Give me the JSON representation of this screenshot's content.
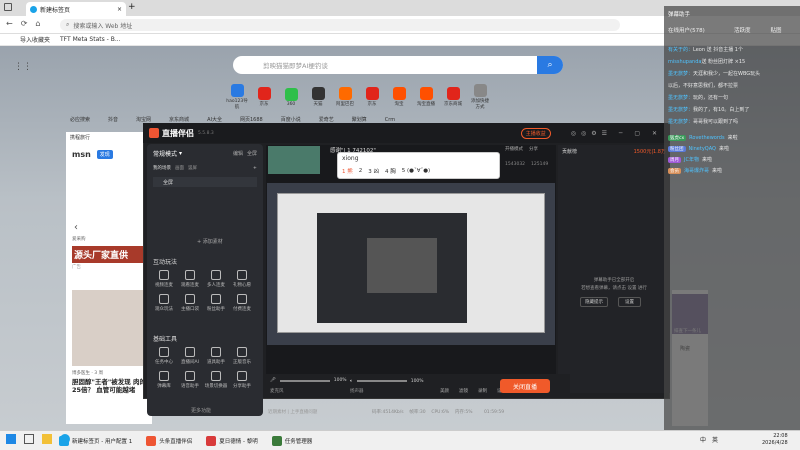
{
  "browser": {
    "tab_title": "新建标签页",
    "address_placeholder": "搜索或输入 Web 地址",
    "favorites": [
      "导入收藏夹",
      "TFT Meta Stats - B..."
    ],
    "search_placeholder": "剪映猫猫即梦AI梗钓谈",
    "quick_links": [
      {
        "label": "hao123导航",
        "color": "#2a7ae2"
      },
      {
        "label": "京东",
        "color": "#e1251b"
      },
      {
        "label": "360",
        "color": "#2fbf4a"
      },
      {
        "label": "天猫",
        "color": "#333"
      },
      {
        "label": "阿里巴巴",
        "color": "#ff6a00"
      },
      {
        "label": "京东",
        "color": "#e1251b"
      },
      {
        "label": "淘宝",
        "color": "#ff5000"
      },
      {
        "label": "淘宝直播",
        "color": "#ff5000"
      },
      {
        "label": "京东商城",
        "color": "#e1251b"
      },
      {
        "label": "添加快捷方式",
        "color": "#888"
      }
    ],
    "second_row": [
      "必应搜索",
      "抖音",
      "淘宝网",
      "京东商城",
      "AI大全",
      "网页1688",
      "百度小说",
      "爱奇艺",
      "聚划算",
      "Crm"
    ],
    "travel_label": "携程旅行",
    "msn_brand": "msn",
    "msn_tab": "发现",
    "news1_title": "源头厂家直供",
    "news1_source": "爱采购",
    "news1_tag": "广告",
    "news2_source": "博多医生 · 3 周",
    "news2_title": "胆固醇\"王者\"被发现 肉的25倍？ 血管可能越堵",
    "right_snippet": "排查下一条儿",
    "right_label": "陶瓷"
  },
  "app": {
    "title": "直播伴侣",
    "version": "5.5.8.3",
    "start_live_top": "主播收益",
    "mode_label": "常规模式",
    "edit_label": "编辑",
    "layout_label": "全屏",
    "my_scene": "我的场景",
    "scene_tabs": [
      "画面",
      "竖屏"
    ],
    "fullscreen_label": "全屏",
    "add_material": "+ 添加素材",
    "interactive_title": "互动玩法",
    "interactive_tools": [
      "视频连麦",
      "观看连麦",
      "多人连麦",
      "礼物心愿",
      "观众玩法",
      "主播口袋",
      "粉丝助手",
      "付费连麦"
    ],
    "basic_title": "基础工具",
    "basic_tools": [
      "任务中心",
      "直播间AI",
      "道具助手",
      "正版音乐",
      "弹幕库",
      "语音助手",
      "场景切换器",
      "分享助手"
    ],
    "more_label": "更多功能",
    "notice_text": "近期素材 | 上手直播问题",
    "ime_input": "xiong",
    "ime_candidates": [
      "1 熊",
      "2 ",
      "3 凶",
      "4 胸",
      "5 (●ˇ∀ˇ●)"
    ],
    "live_title": "感谢\"| 1 742102\"",
    "play_count_label": "开播模式",
    "share_label": "分享",
    "stat_a": "1543032",
    "stat_b": "125149",
    "rank_label": "贡献榜",
    "rank_value": "1500元|1.8万",
    "comment_empty": "弹幕助手已全部开启",
    "comment_hint": "若想查看弹幕，请点击 设置 进行",
    "settings_btn": "设置",
    "hide_btn": "隐藏提示",
    "mic_label": "麦克风",
    "mic_value": "100%",
    "speaker_label": "扬声器",
    "speaker_value": "100%",
    "beauty_label": "美颜",
    "effect_label": "滤镜",
    "record_label": "录制",
    "setting_label": "设置",
    "live_button": "关闭直播",
    "status_bar": "码率:4514Kb/s    帧率:30    CPU:6%    内存:5%        01:59:59"
  },
  "chat": {
    "header_left": "弹幕助手",
    "online": "在线用户(578)",
    "tabs": [
      "活跃度",
      "贴图"
    ],
    "messages": [
      {
        "user": "有关于的：",
        "text": "Leon 送 抖音主播 1个"
      },
      {
        "user": "misshupanda",
        "text": "送 粉丝团灯牌 ×15"
      },
      {
        "user": "墨无旅梦：",
        "text": "天涯和我少，一起在WBG玩头"
      },
      {
        "user": "",
        "text": "以后，不好意思我们，都不拉票"
      },
      {
        "user": "墨无旅梦：",
        "text": "玩的，还有一句"
      },
      {
        "user": "墨无旅梦：",
        "text": "我的了，有10。白上到了"
      },
      {
        "user": "墨无旅梦：",
        "text": "哥哥我可以跟到了吗"
      }
    ],
    "joins": [
      {
        "badge": "猛虎cx",
        "name": "Rovethewords",
        "text": "来啦"
      },
      {
        "badge": "粉丝团",
        "name": "NinetyQAQ",
        "text": "来啦"
      },
      {
        "badge": "周月",
        "name": "JC年物",
        "text": "来啦"
      },
      {
        "badge": "会员",
        "name": "海哥爆炸哥",
        "text": "来啦"
      }
    ]
  },
  "taskbar": {
    "items": [
      "新建标签页 - 用户配置 1",
      "头条直播伴侣",
      "夏日德情 - 黎明",
      "任务管理器"
    ],
    "tray": [
      "中",
      "英"
    ],
    "time": "22:08",
    "date": "2026/4/28"
  }
}
